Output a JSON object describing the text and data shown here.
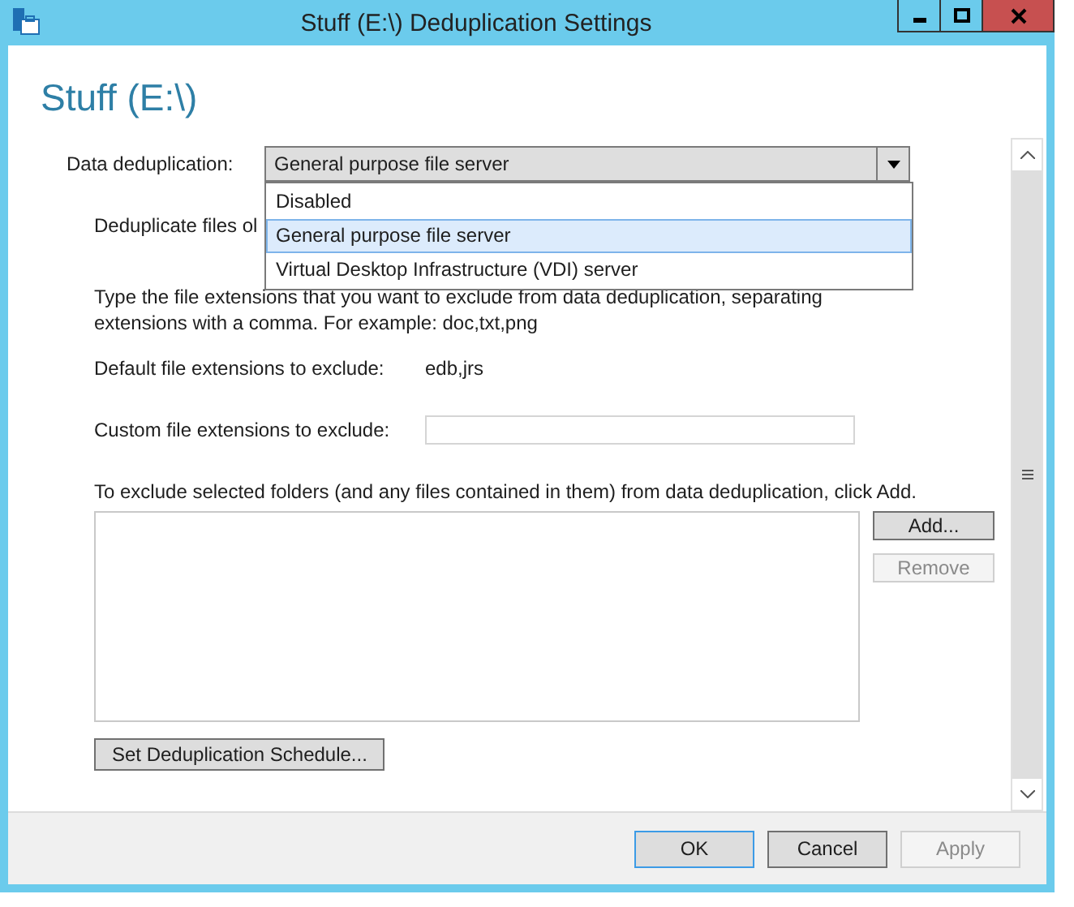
{
  "window": {
    "title": "Stuff (E:\\) Deduplication Settings"
  },
  "heading": "Stuff (E:\\)",
  "dedup": {
    "label": "Data deduplication:",
    "value": "General purpose file server",
    "expanded": true,
    "options": [
      {
        "label": "Disabled",
        "selected": false
      },
      {
        "label": "General purpose file server",
        "selected": true
      },
      {
        "label": "Virtual Desktop Infrastructure (VDI) server",
        "selected": false
      }
    ]
  },
  "age_label": "Deduplicate files ol",
  "extensions_help": "Type the file extensions that you want to exclude from data deduplication, separating extensions with a comma. For example: doc,txt,png",
  "default_extensions": {
    "label": "Default file extensions to exclude:",
    "value": "edb,jrs"
  },
  "custom_extensions": {
    "label": "Custom file extensions to exclude:"
  },
  "folders_help": "To exclude selected folders (and any files contained in them) from data deduplication, click Add.",
  "folder_buttons": [
    {
      "label": "Add...",
      "disabled": false
    },
    {
      "label": "Remove",
      "disabled": true
    }
  ],
  "schedule_button": "Set Deduplication Schedule...",
  "footer_buttons": [
    {
      "label": "OK",
      "default": true,
      "disabled": false
    },
    {
      "label": "Cancel",
      "default": false,
      "disabled": false
    },
    {
      "label": "Apply",
      "default": false,
      "disabled": true
    }
  ]
}
